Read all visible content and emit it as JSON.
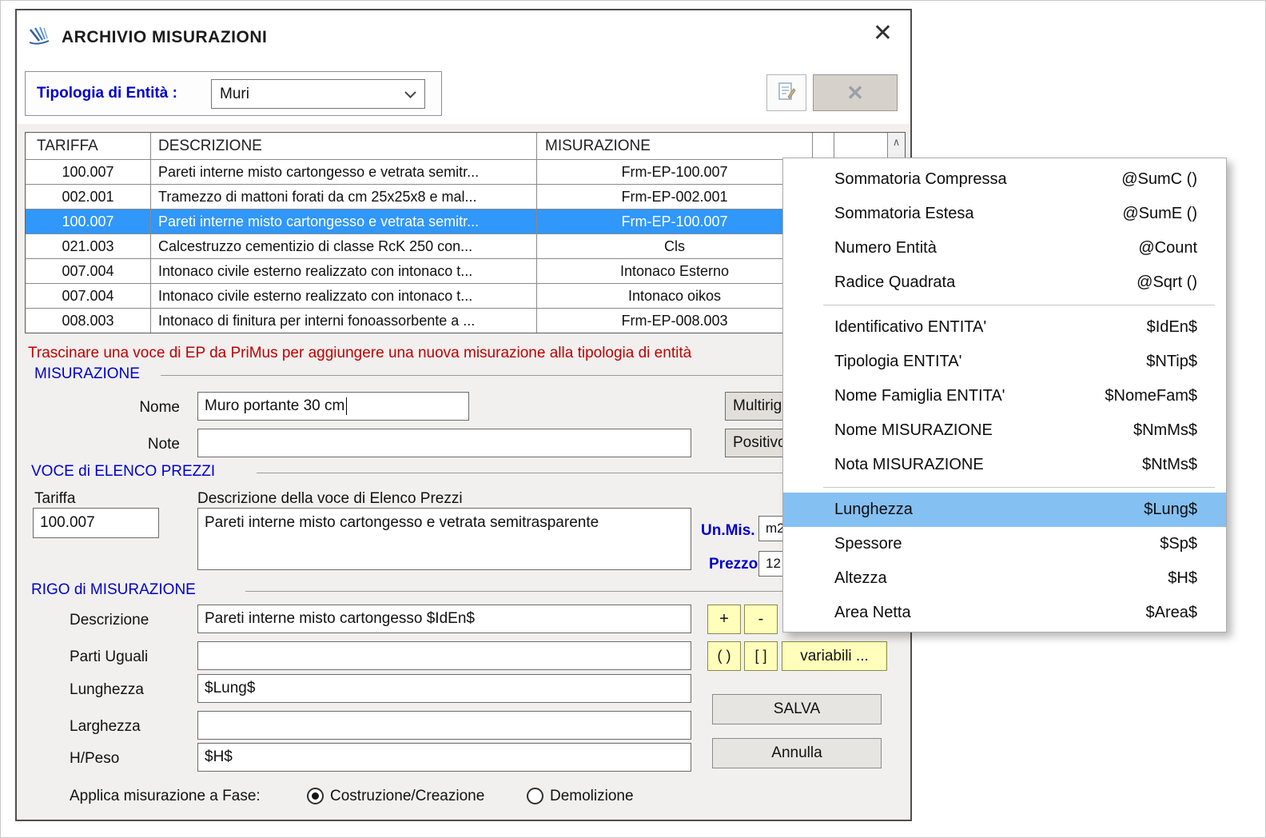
{
  "window": {
    "title": "ARCHIVIO MISURAZIONI",
    "close_icon": "✕"
  },
  "entity_bar": {
    "label": "Tipologia di Entità :",
    "value": "Muri"
  },
  "toolbar": {
    "delete_icon": "✕"
  },
  "table": {
    "headers": {
      "tariffa": "TARIFFA",
      "descrizione": "DESCRIZIONE",
      "misurazione": "MISURAZIONE"
    },
    "scroll_up_icon": "∧",
    "rows": [
      {
        "tariffa": "100.007",
        "descrizione": "Pareti interne misto cartongesso e vetrata semitr...",
        "misurazione": "Frm-EP-100.007"
      },
      {
        "tariffa": "002.001",
        "descrizione": "Tramezzo di mattoni forati da cm 25x25x8 e mal...",
        "misurazione": "Frm-EP-002.001"
      },
      {
        "tariffa": "100.007",
        "descrizione": "Pareti interne misto cartongesso e vetrata semitr...",
        "misurazione": "Frm-EP-100.007"
      },
      {
        "tariffa": "021.003",
        "descrizione": "Calcestruzzo cementizio di classe RcK 250 con...",
        "misurazione": "Cls"
      },
      {
        "tariffa": "007.004",
        "descrizione": "Intonaco civile esterno realizzato con intonaco t...",
        "misurazione": "Intonaco Esterno"
      },
      {
        "tariffa": "007.004",
        "descrizione": "Intonaco civile esterno realizzato con intonaco t...",
        "misurazione": "Intonaco oikos"
      },
      {
        "tariffa": "008.003",
        "descrizione": "Intonaco di finitura per interni fonoassorbente a ...",
        "misurazione": "Frm-EP-008.003"
      }
    ]
  },
  "hint": "Trascinare una voce di EP da PriMus per aggiungere una nuova misurazione alla tipologia di entità",
  "misurazione": {
    "group_label": "MISURAZIONE",
    "nome_label": "Nome",
    "nome_value": "Muro portante 30 cm",
    "note_label": "Note",
    "note_value": "",
    "multirig_button": "Multirig",
    "positivo_button": "Positivo"
  },
  "voce_ep": {
    "group_label": "VOCE di ELENCO PREZZI",
    "tariffa_label": "Tariffa",
    "tariffa_value": "100.007",
    "descrizione_label": "Descrizione della voce di Elenco Prezzi",
    "descrizione_value": "Pareti interne misto cartongesso e vetrata semitrasparente",
    "unmis_label": "Un.Mis.",
    "unmis_value": "m2",
    "prezzo_label": "Prezzo",
    "prezzo_value": "12"
  },
  "rigo": {
    "group_label": "RIGO di MISURAZIONE",
    "descrizione_label": "Descrizione",
    "descrizione_value": "Pareti interne misto cartongesso $IdEn$",
    "parti_label": "Parti Uguali",
    "parti_value": "",
    "lunghezza_label": "Lunghezza",
    "lunghezza_value": "$Lung$",
    "larghezza_label": "Larghezza",
    "larghezza_value": "",
    "hpeso_label": "H/Peso",
    "hpeso_value": "$H$",
    "plus_button": "+",
    "minus_button": "-",
    "paren_button": "( )",
    "bracket_button": "[ ]",
    "variabili_button": "variabili ...",
    "salva_button": "SALVA",
    "annulla_button": "Annulla",
    "fase_label": "Applica misurazione a Fase:",
    "fase_options": [
      "Costruzione/Creazione",
      "Demolizione"
    ]
  },
  "menu": {
    "items": [
      {
        "label": "Sommatoria Compressa",
        "code": "@SumC ()"
      },
      {
        "label": "Sommatoria Estesa",
        "code": "@SumE ()"
      },
      {
        "label": "Numero Entità",
        "code": "@Count"
      },
      {
        "label": "Radice Quadrata",
        "code": "@Sqrt ()"
      },
      {
        "label": "Identificativo ENTITA'",
        "code": "$IdEn$"
      },
      {
        "label": "Tipologia ENTITA'",
        "code": "$NTip$"
      },
      {
        "label": "Nome Famiglia ENTITA'",
        "code": "$NomeFam$"
      },
      {
        "label": "Nome MISURAZIONE",
        "code": "$NmMs$"
      },
      {
        "label": "Nota MISURAZIONE",
        "code": "$NtMs$"
      },
      {
        "label": "Lunghezza",
        "code": "$Lung$"
      },
      {
        "label": "Spessore",
        "code": "$Sp$"
      },
      {
        "label": "Altezza",
        "code": "$H$"
      },
      {
        "label": "Area Netta",
        "code": "$Area$"
      }
    ]
  },
  "colors": {
    "accent_blue": "#0000cd",
    "hint_red": "#c00000",
    "row_selection": "#3097fb",
    "menu_highlight": "#84c0f2",
    "button_yellow": "#ffffbb"
  }
}
